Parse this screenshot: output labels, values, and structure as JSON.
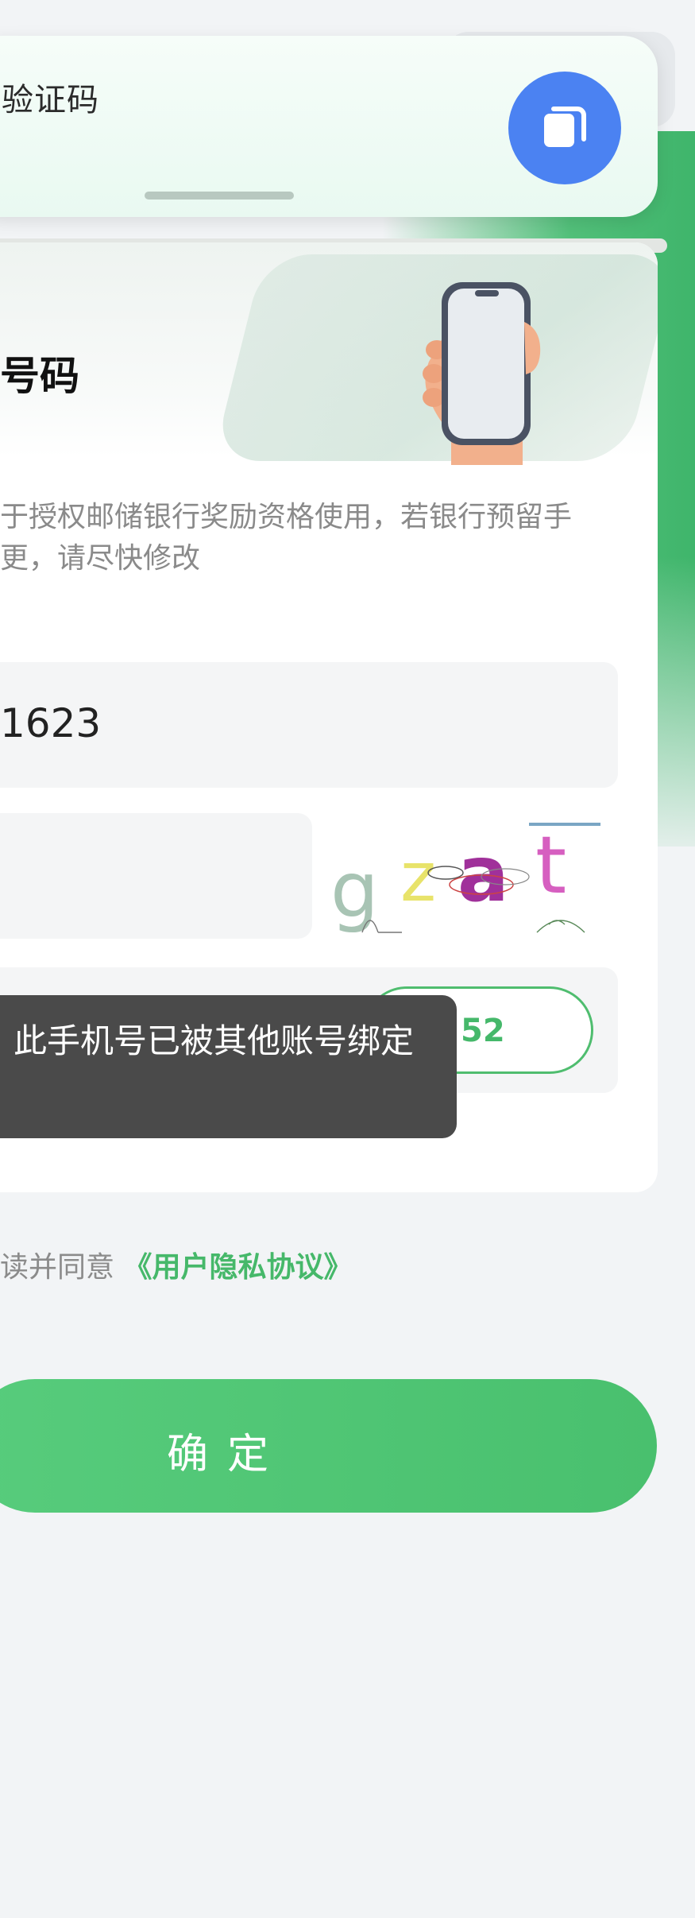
{
  "notification": {
    "title": "验证码",
    "icon": "copy-icon",
    "icon_color": "#4b82f2"
  },
  "card": {
    "title": "号码",
    "description": "于授权邮储银行奖励资格使用，若银行预留手更，请尽快修改"
  },
  "form": {
    "phone_value": "1623",
    "captcha_text": "gzat",
    "sms_button_label": "52"
  },
  "toast": {
    "message": "此手机号已被其他账号绑定"
  },
  "agreement": {
    "prefix": "读并同意",
    "link_label": "《用户隐私协议》"
  },
  "confirm_button": {
    "label": "确定"
  },
  "colors": {
    "accent_green": "#4fbd6f",
    "toast_bg": "#4a4a4a"
  }
}
